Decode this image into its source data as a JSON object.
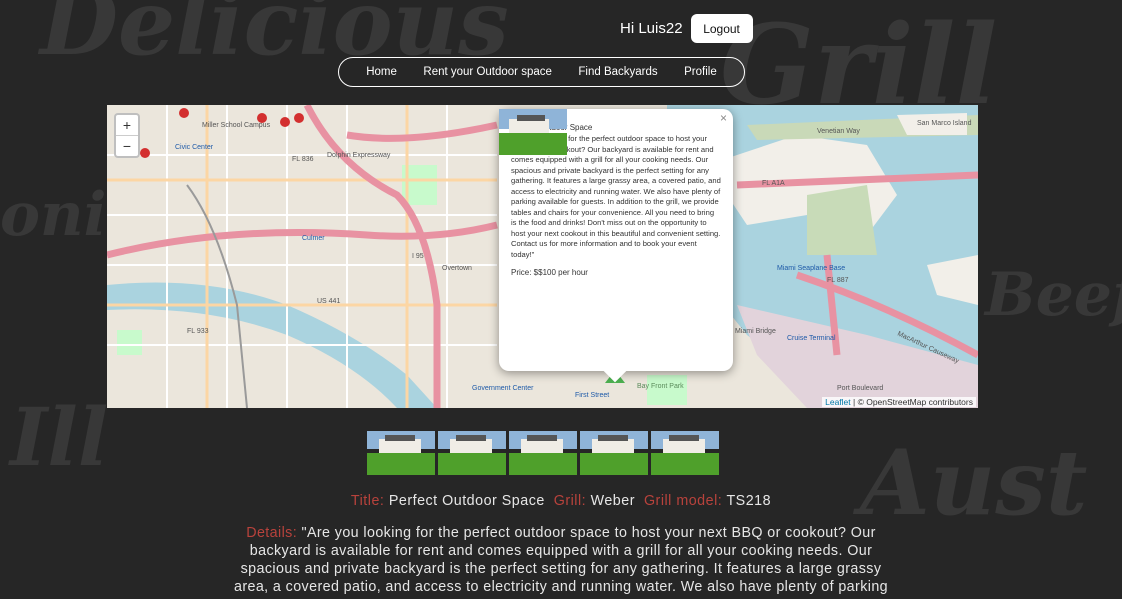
{
  "header": {
    "greeting": "Hi Luis22",
    "logout_label": "Logout"
  },
  "nav": {
    "items": [
      {
        "label": "Home"
      },
      {
        "label": "Rent your Outdoor space"
      },
      {
        "label": "Find Backyards"
      },
      {
        "label": "Profile"
      }
    ]
  },
  "map": {
    "zoom_in": "+",
    "zoom_out": "−",
    "attribution_leaflet": "Leaflet",
    "attribution_rest": "| © OpenStreetMap contributors",
    "labels": {
      "civic_center": "Civic Center",
      "miller_school": "Miller School Campus",
      "dolphin": "Dolphin Expressway",
      "fl836": "FL 836",
      "overtown": "Overtown",
      "culmer": "Culmer",
      "us441": "US 441",
      "fl933": "FL 933",
      "i95": "I 95",
      "government_center": "Government Center",
      "first_street": "First Street",
      "bayfront": "Bay Front Park",
      "miami_bridge": "Miami Bridge",
      "venetian": "Venetian Way",
      "fla1a": "FL A1A",
      "fl887": "FL 887",
      "seaplane": "Miami Seaplane Base",
      "macarthur": "MacArthur Causeway",
      "cruise_terminal": "Cruise Terminal",
      "port_boulevard": "Port Boulevard",
      "san_marco": "San Marco Island"
    },
    "popup": {
      "close": "×",
      "title": "Perfect Outdoor Space",
      "description": "\"Are you looking for the perfect outdoor space to host your next BBQ or cookout? Our backyard is available for rent and comes equipped with a grill for all your cooking needs. Our spacious and private backyard is the perfect setting for any gathering. It features a large grassy area, a covered patio, and access to electricity and running water. We also have plenty of parking available for guests. In addition to the grill, we provide tables and chairs for your convenience. All you need to bring is the food and drinks! Don't miss out on the opportunity to host your next cookout in this beautiful and convenient setting. Contact us for more information and to book your event today!\"",
      "price": "Price: $$100 per hour"
    }
  },
  "listing": {
    "title_label": "Title:",
    "title_value": "Perfect Outdoor Space",
    "grill_label": "Grill:",
    "grill_value": "Weber",
    "model_label": "Grill model:",
    "model_value": "TS218",
    "details_label": "Details:",
    "details_value": "\"Are you looking for the perfect outdoor space to host your next BBQ or cookout? Our backyard is available for rent and comes equipped with a grill for all your cooking needs. Our spacious and private backyard is the perfect setting for any gathering. It features a large grassy area, a covered patio, and access to electricity and running water. We also have plenty of parking"
  },
  "colors": {
    "background": "#262626",
    "label_accent": "#b8423c",
    "water": "#aad3df",
    "highway": "#e892a2",
    "primary_road": "#fcd6a4"
  }
}
